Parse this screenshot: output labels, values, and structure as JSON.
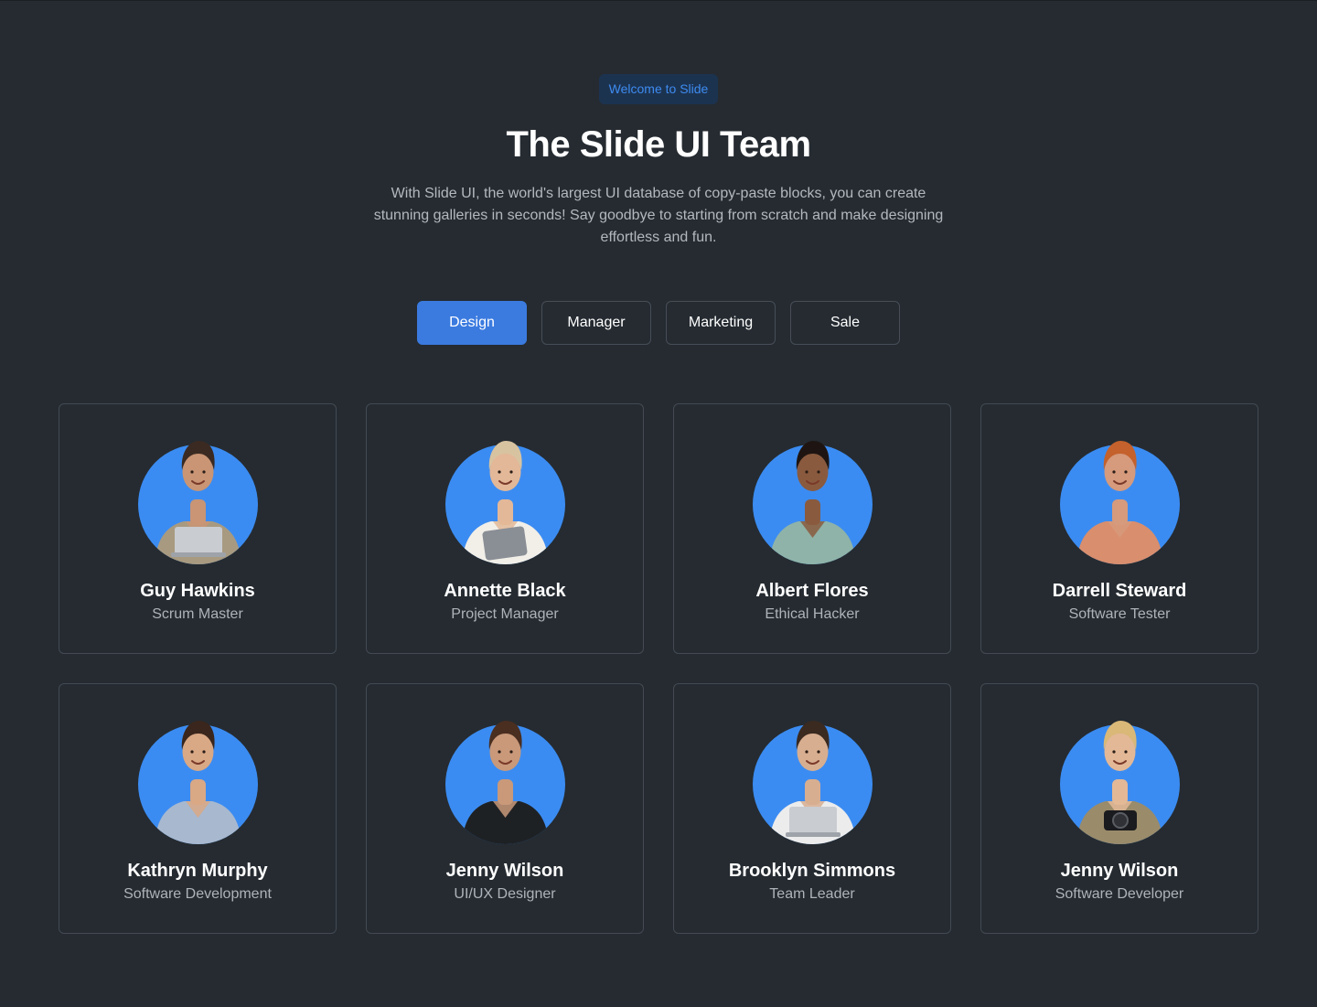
{
  "header": {
    "badge": "Welcome to Slide",
    "title": "The Slide UI Team",
    "subtitle": "With Slide UI, the world's largest UI database of copy-paste blocks, you can create stunning galleries in seconds! Say goodbye to starting from scratch and make designing effortless and fun."
  },
  "tabs": [
    {
      "label": "Design",
      "active": true
    },
    {
      "label": "Manager",
      "active": false
    },
    {
      "label": "Marketing",
      "active": false
    },
    {
      "label": "Sale",
      "active": false
    }
  ],
  "members": [
    {
      "name": "Guy Hawkins",
      "role": "Scrum Master",
      "skin": "#c99574",
      "hair": "#3b2a22",
      "shirt": "#a89a80",
      "prop": "laptop"
    },
    {
      "name": "Annette Black",
      "role": "Project Manager",
      "skin": "#e3b898",
      "hair": "#d8c3a0",
      "shirt": "#f2efe8",
      "prop": "tablet"
    },
    {
      "name": "Albert Flores",
      "role": "Ethical Hacker",
      "skin": "#8a5a3e",
      "hair": "#1e1512",
      "shirt": "#8fb3a8",
      "prop": "none"
    },
    {
      "name": "Darrell Steward",
      "role": "Software Tester",
      "skin": "#d69a7c",
      "hair": "#c4612c",
      "shirt": "#d98e6d",
      "prop": "none"
    },
    {
      "name": "Kathryn Murphy",
      "role": "Software Development",
      "skin": "#d9a885",
      "hair": "#3a261c",
      "shirt": "#a7b8cf",
      "prop": "none"
    },
    {
      "name": "Jenny Wilson",
      "role": "UI/UX Designer",
      "skin": "#c9997a",
      "hair": "#4a2e20",
      "shirt": "#1e2124",
      "prop": "none"
    },
    {
      "name": "Brooklyn Simmons",
      "role": "Team Leader",
      "skin": "#d8ae90",
      "hair": "#3a2a20",
      "shirt": "#ececec",
      "prop": "laptop"
    },
    {
      "name": "Jenny Wilson",
      "role": "Software Developer",
      "skin": "#e3b896",
      "hair": "#d9b878",
      "shirt": "#9a8b6a",
      "prop": "camera"
    }
  ]
}
